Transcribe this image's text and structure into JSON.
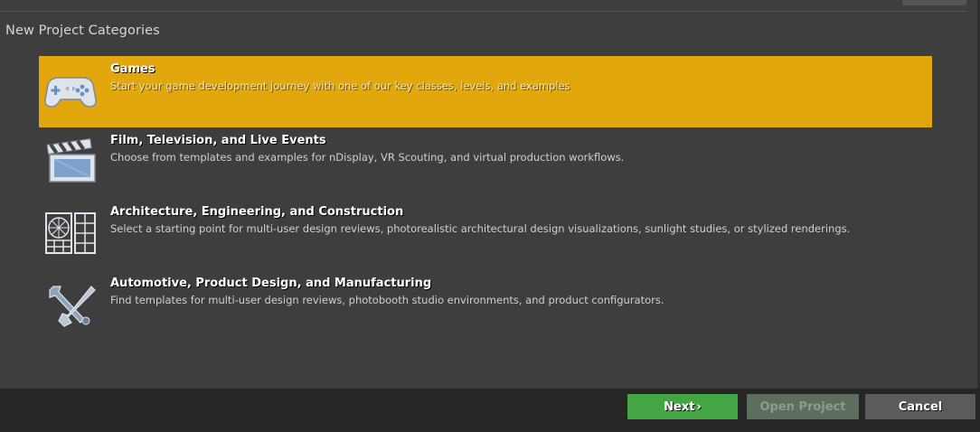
{
  "section_title": "New Project Categories",
  "categories": [
    {
      "title": "Games",
      "description": "Start your game development journey with one of our key classes, levels, and examples",
      "icon": "gamepad-icon",
      "selected": true
    },
    {
      "title": "Film, Television, and Live Events",
      "description": "Choose from templates and examples for nDisplay, VR Scouting, and virtual production workflows.",
      "icon": "clapperboard-icon",
      "selected": false
    },
    {
      "title": "Architecture, Engineering, and Construction",
      "description": "Select a starting point for multi-user design reviews, photorealistic architectural design visualizations, sunlight studies, or stylized renderings.",
      "icon": "window-grid-icon",
      "selected": false
    },
    {
      "title": "Automotive, Product Design, and Manufacturing",
      "description": "Find templates for multi-user design reviews, photobooth studio environments, and product configurators.",
      "icon": "tools-icon",
      "selected": false
    }
  ],
  "footer": {
    "next_label": "Next",
    "next_arrow": "›",
    "open_project_label": "Open Project",
    "cancel_label": "Cancel"
  },
  "colors": {
    "selected_bg": "#e1a70c",
    "next_bg": "#44a544",
    "background": "#3e3e3e"
  }
}
